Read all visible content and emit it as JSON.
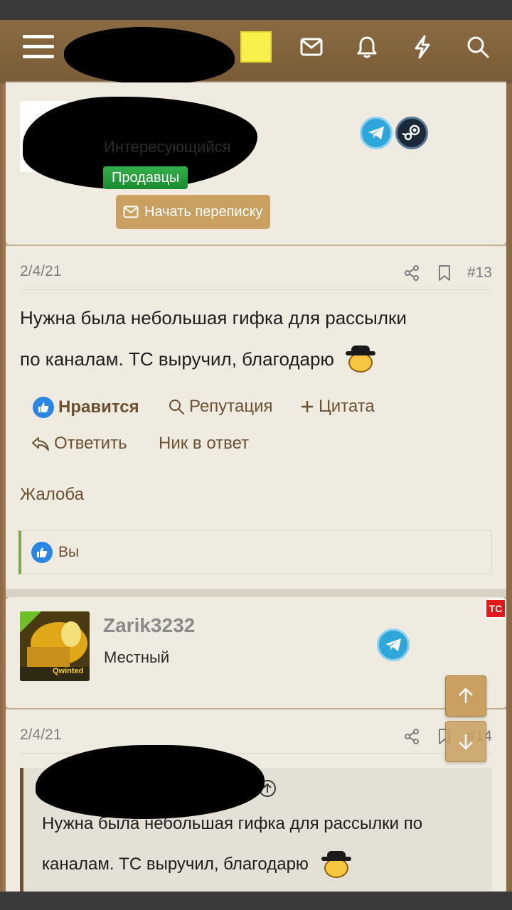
{
  "nav": {
    "icons": [
      "menu-icon",
      "envelope-icon",
      "bell-icon",
      "lightning-icon",
      "search-icon"
    ]
  },
  "user1": {
    "title": "Интересующийся",
    "badge": "Продавцы",
    "message_button": "Начать переписку",
    "social": [
      "telegram-icon",
      "steam-icon"
    ]
  },
  "post13": {
    "date": "2/4/21",
    "number": "#13",
    "text_line1": "Нужна была небольшая гифка для рассылки",
    "text_line2": "по каналам. ТС выручил, благодарю",
    "actions": {
      "like": "Нравится",
      "reputation": "Репутация",
      "quote": "Цитата",
      "reply": "Ответить",
      "nick_reply": "Ник в ответ",
      "report": "Жалоба"
    },
    "likes_by": "Вы"
  },
  "user2": {
    "name": "Zarik3232",
    "title": "Местный",
    "tc_badge": "ТС",
    "avatar_text": "Qwinted"
  },
  "post14": {
    "date": "2/4/21",
    "number": "#14",
    "quote_line1": "Нужна была небольшая гифка для рассылки по",
    "quote_line2": "каналам. ТС выручил, благодарю"
  },
  "colors": {
    "header": "#7a5c37",
    "accent": "#c9a060",
    "telegram": "#2ea6da",
    "like": "#2a86e0",
    "seller_badge": "#1a8a2e"
  }
}
